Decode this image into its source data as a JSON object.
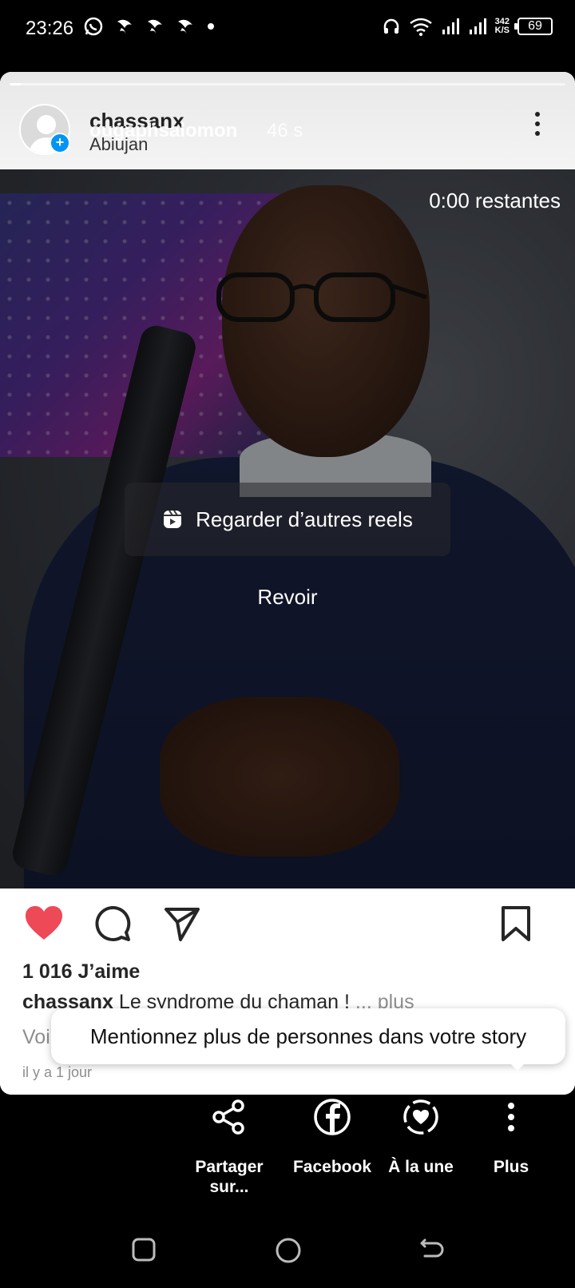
{
  "status_bar": {
    "time": "23:26",
    "network_speed_value": "342",
    "network_speed_unit": "K/S",
    "battery": "69"
  },
  "story": {
    "progress": 0.02,
    "poster_username": "chassanx",
    "overlay_username": "ougaphsalomon",
    "time_ago": "46 s",
    "location": "Abiujan"
  },
  "video": {
    "remaining": "0:00 restantes",
    "reels_button_label": "Regarder d’autres reels",
    "replay_label": "Revoir"
  },
  "post": {
    "likes": "1 016 J’aime",
    "caption_user": "chassanx",
    "caption_text": " Le syndrome du chaman !",
    "caption_more": "... plus",
    "view_comments": "Voi",
    "date": "il y a 1 jour",
    "liked": true
  },
  "tooltip": {
    "text": "Mentionnez plus de personnes dans votre story"
  },
  "share": {
    "items": [
      {
        "label": "Partager sur...",
        "icon": "share-nodes-icon"
      },
      {
        "label": "Facebook",
        "icon": "facebook-icon"
      },
      {
        "label": "À la une",
        "icon": "highlight-icon"
      },
      {
        "label": "Plus",
        "icon": "more-vertical-icon"
      }
    ]
  },
  "colors": {
    "like_red": "#ed4956",
    "accent_blue": "#0095f6"
  }
}
